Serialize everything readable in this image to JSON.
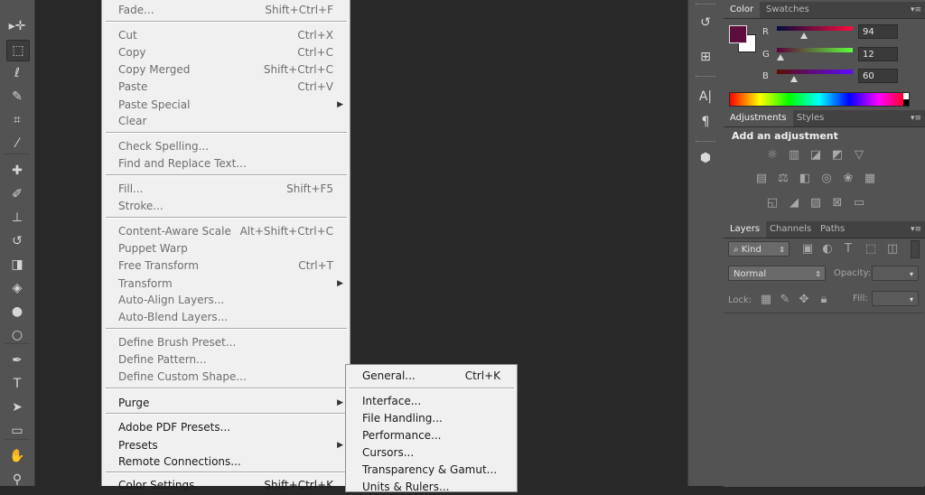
{
  "toolbar": {
    "tools": [
      "move-tool-icon",
      "marquee-tool-icon",
      "lasso-tool-icon",
      "quick-selection-tool-icon",
      "crop-tool-icon",
      "eyedropper-tool-icon",
      "healing-brush-tool-icon",
      "brush-tool-icon",
      "clone-stamp-tool-icon",
      "history-brush-tool-icon",
      "eraser-tool-icon",
      "paint-bucket-tool-icon",
      "blur-tool-icon",
      "dodge-tool-icon",
      "pen-tool-icon",
      "type-tool-icon",
      "path-selection-tool-icon",
      "rectangle-tool-icon",
      "hand-tool-icon",
      "zoom-tool-icon"
    ]
  },
  "edit_menu": {
    "items": [
      {
        "label": "Fade...",
        "shortcut": "Shift+Ctrl+F",
        "enabled": false
      },
      {
        "label": "Cut",
        "shortcut": "Ctrl+X",
        "enabled": false
      },
      {
        "label": "Copy",
        "shortcut": "Ctrl+C",
        "enabled": false
      },
      {
        "label": "Copy Merged",
        "shortcut": "Shift+Ctrl+C",
        "enabled": false
      },
      {
        "label": "Paste",
        "shortcut": "Ctrl+V",
        "enabled": false
      },
      {
        "label": "Paste Special",
        "shortcut": "",
        "enabled": false,
        "submenu": true
      },
      {
        "label": "Clear",
        "shortcut": "",
        "enabled": false
      },
      {
        "label": "Check Spelling...",
        "shortcut": "",
        "enabled": false
      },
      {
        "label": "Find and Replace Text...",
        "shortcut": "",
        "enabled": false
      },
      {
        "label": "Fill...",
        "shortcut": "Shift+F5",
        "enabled": false
      },
      {
        "label": "Stroke...",
        "shortcut": "",
        "enabled": false
      },
      {
        "label": "Content-Aware Scale",
        "shortcut": "Alt+Shift+Ctrl+C",
        "enabled": false
      },
      {
        "label": "Puppet Warp",
        "shortcut": "",
        "enabled": false
      },
      {
        "label": "Free Transform",
        "shortcut": "Ctrl+T",
        "enabled": false
      },
      {
        "label": "Transform",
        "shortcut": "",
        "enabled": false,
        "submenu": true
      },
      {
        "label": "Auto-Align Layers...",
        "shortcut": "",
        "enabled": false
      },
      {
        "label": "Auto-Blend Layers...",
        "shortcut": "",
        "enabled": false
      },
      {
        "label": "Define Brush Preset...",
        "shortcut": "",
        "enabled": false
      },
      {
        "label": "Define Pattern...",
        "shortcut": "",
        "enabled": false
      },
      {
        "label": "Define Custom Shape...",
        "shortcut": "",
        "enabled": false
      },
      {
        "label": "Purge",
        "shortcut": "",
        "enabled": true,
        "submenu": true
      },
      {
        "label": "Adobe PDF Presets...",
        "shortcut": "",
        "enabled": true
      },
      {
        "label": "Presets",
        "shortcut": "",
        "enabled": true,
        "submenu": true
      },
      {
        "label": "Remote Connections...",
        "shortcut": "",
        "enabled": true
      },
      {
        "label": "Color Settings...",
        "shortcut": "Shift+Ctrl+K",
        "enabled": true
      }
    ]
  },
  "preferences_submenu": {
    "items": [
      {
        "label": "General...",
        "shortcut": "Ctrl+K"
      },
      {
        "label": "Interface...",
        "shortcut": ""
      },
      {
        "label": "File Handling...",
        "shortcut": ""
      },
      {
        "label": "Performance...",
        "shortcut": ""
      },
      {
        "label": "Cursors...",
        "shortcut": ""
      },
      {
        "label": "Transparency & Gamut...",
        "shortcut": ""
      },
      {
        "label": "Units & Rulers...",
        "shortcut": ""
      }
    ]
  },
  "color_panel": {
    "tabs": [
      "Color",
      "Swatches"
    ],
    "channels": [
      {
        "name": "R",
        "value": "94"
      },
      {
        "name": "G",
        "value": "12"
      },
      {
        "name": "B",
        "value": "60"
      }
    ],
    "foreground_color": "#5e0c3c",
    "background_color": "#ffffff"
  },
  "adjustments_panel": {
    "tabs": [
      "Adjustments",
      "Styles"
    ],
    "heading": "Add an adjustment"
  },
  "layers_panel": {
    "tabs": [
      "Layers",
      "Channels",
      "Paths"
    ],
    "filter_kind": "Kind",
    "blend_mode": "Normal",
    "opacity_label": "Opacity:",
    "lock_label": "Lock:",
    "fill_label": "Fill:"
  }
}
